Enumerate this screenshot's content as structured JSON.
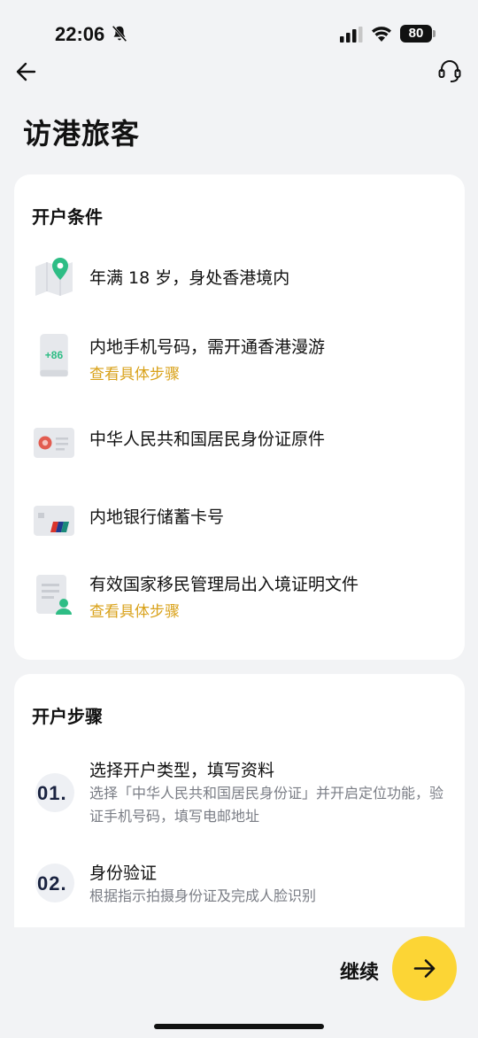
{
  "status_bar": {
    "time": "22:06",
    "battery": "80"
  },
  "header": {
    "title": "访港旅客"
  },
  "requirements": {
    "title": "开户条件",
    "items": [
      {
        "text": "年满 18 岁，身处香港境内",
        "link": "",
        "icon": "map-pin-icon"
      },
      {
        "text": "内地手机号码，需开通香港漫游",
        "link": "查看具体步骤",
        "icon": "phone-plus86-icon",
        "icon_label": "+86"
      },
      {
        "text": "中华人民共和国居民身份证原件",
        "link": "",
        "icon": "id-card-icon"
      },
      {
        "text": "内地银行储蓄卡号",
        "link": "",
        "icon": "bank-card-icon"
      },
      {
        "text": "有效国家移民管理局出入境证明文件",
        "link": "查看具体步骤",
        "icon": "document-person-icon"
      }
    ]
  },
  "steps": {
    "title": "开户步骤",
    "items": [
      {
        "num": "01.",
        "title": "选择开户类型，填写资料",
        "desc": "选择「中华人民共和国居民身份证」并开启定位功能，验证手机号码，填写电邮地址"
      },
      {
        "num": "02.",
        "title": "身份验证",
        "desc": "根据指示拍摄身份证及完成人脸识别"
      }
    ]
  },
  "footer": {
    "continue_label": "继续"
  },
  "colors": {
    "accent": "#fcd535",
    "link": "#d9a21b",
    "green": "#2ebd85"
  }
}
